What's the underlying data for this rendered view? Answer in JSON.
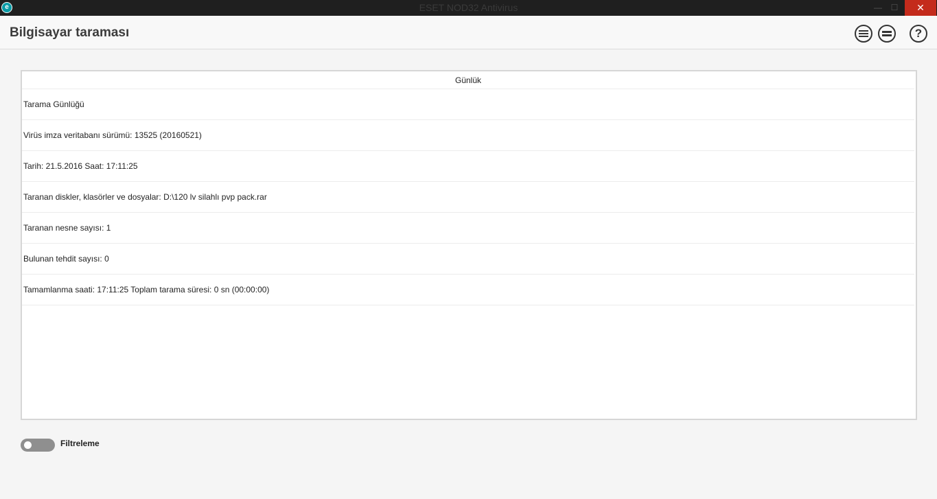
{
  "window": {
    "title": "ESET NOD32 Antivirus",
    "app_icon_letter": "e",
    "minimize_glyph": "—",
    "maximize_glyph": "☐",
    "close_glyph": "✕"
  },
  "header": {
    "title": "Bilgisayar taraması",
    "icons": [
      "menu-list-icon",
      "collapse-icon",
      "help-icon"
    ],
    "help_glyph": "?"
  },
  "log": {
    "column_header": "Günlük",
    "rows": [
      "Tarama Günlüğü",
      "Virüs imza veritabanı sürümü: 13525 (20160521)",
      "Tarih: 21.5.2016  Saat: 17:11:25",
      "Taranan diskler, klasörler ve dosyalar: D:\\120 lv silahlı pvp pack.rar",
      "Taranan nesne sayısı: 1",
      "Bulunan tehdit sayısı: 0",
      "Tamamlanma saati: 17:11:25  Toplam tarama süresi: 0 sn (00:00:00)"
    ]
  },
  "filter": {
    "label": "Filtreleme",
    "enabled": false
  },
  "colors": {
    "accent": "#0a9ba6",
    "close_button": "#c42b1c",
    "titlebar": "#1f1f1f"
  }
}
